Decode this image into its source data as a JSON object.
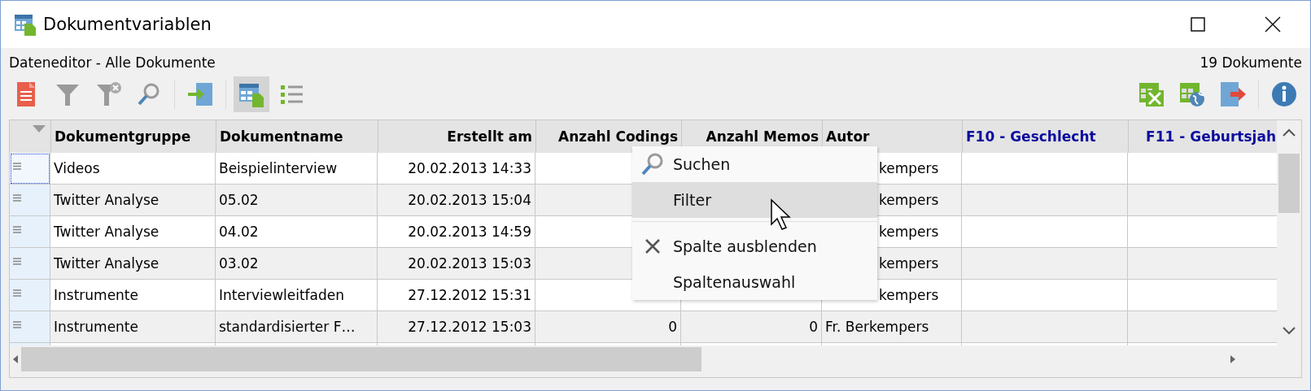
{
  "window": {
    "title": "Dokumentvariablen"
  },
  "header": {
    "title": "Dateneditor - Alle Dokumente",
    "count": "19 Dokumente"
  },
  "toolbar": {
    "left": [
      {
        "kind": "document",
        "selected": false
      },
      {
        "kind": "filter",
        "selected": false
      },
      {
        "kind": "clear-filter",
        "selected": false
      },
      {
        "kind": "search",
        "selected": false
      },
      {
        "kind": "separator"
      },
      {
        "kind": "import",
        "selected": false
      },
      {
        "kind": "separator"
      },
      {
        "kind": "table-view",
        "selected": true
      },
      {
        "kind": "list-view",
        "selected": false
      }
    ],
    "right": [
      {
        "kind": "excel-export",
        "selected": false
      },
      {
        "kind": "web-export",
        "selected": false
      },
      {
        "kind": "export",
        "selected": false
      },
      {
        "kind": "separator"
      },
      {
        "kind": "info",
        "selected": false
      }
    ]
  },
  "table": {
    "columns": [
      {
        "label": "Dokumentgruppe",
        "kind": "text",
        "variable": false
      },
      {
        "label": "Dokumentname",
        "kind": "text",
        "variable": false
      },
      {
        "label": "Erstellt am",
        "kind": "date",
        "variable": false
      },
      {
        "label": "Anzahl Codings",
        "kind": "number",
        "variable": false
      },
      {
        "label": "Anzahl Memos",
        "kind": "number",
        "variable": false
      },
      {
        "label": "Autor",
        "kind": "text",
        "variable": false
      },
      {
        "label": "F10 - Geschlecht",
        "kind": "text",
        "variable": true
      },
      {
        "label": "F11 - Geburtsjah",
        "kind": "number",
        "variable": true
      }
    ],
    "rows": [
      {
        "selected": true,
        "under_menu": true,
        "cells": [
          "Videos",
          "Beispielinterview",
          "20.02.2013 14:33",
          null,
          null,
          "kempers",
          null,
          null
        ]
      },
      {
        "selected": false,
        "under_menu": true,
        "cells": [
          "Twitter Analyse",
          "05.02",
          "20.02.2013 15:04",
          null,
          null,
          "kempers",
          null,
          null
        ]
      },
      {
        "selected": false,
        "under_menu": true,
        "cells": [
          "Twitter Analyse",
          "04.02",
          "20.02.2013 14:59",
          null,
          null,
          "kempers",
          null,
          null
        ]
      },
      {
        "selected": false,
        "under_menu": true,
        "cells": [
          "Twitter Analyse",
          "03.02",
          "20.02.2013 15:03",
          null,
          null,
          "kempers",
          null,
          null
        ]
      },
      {
        "selected": false,
        "under_menu": true,
        "cells": [
          "Instrumente",
          "Interviewleitfaden",
          "27.12.2012 15:31",
          null,
          null,
          "kempers",
          null,
          null
        ]
      },
      {
        "selected": false,
        "under_menu": false,
        "cells": [
          "Instrumente",
          "standardisierter F…",
          "27.12.2012 15:03",
          "0",
          "0",
          "Fr. Berkempers",
          null,
          null
        ]
      }
    ]
  },
  "context_menu": {
    "items": [
      {
        "kind": "search",
        "label": "Suchen",
        "hovered": false
      },
      {
        "kind": "plain",
        "label": "Filter",
        "hovered": true
      },
      {
        "kind": "separator"
      },
      {
        "kind": "hide",
        "label": "Spalte ausblenden",
        "hovered": false
      },
      {
        "kind": "plain",
        "label": "Spaltenauswahl",
        "hovered": false
      }
    ]
  }
}
